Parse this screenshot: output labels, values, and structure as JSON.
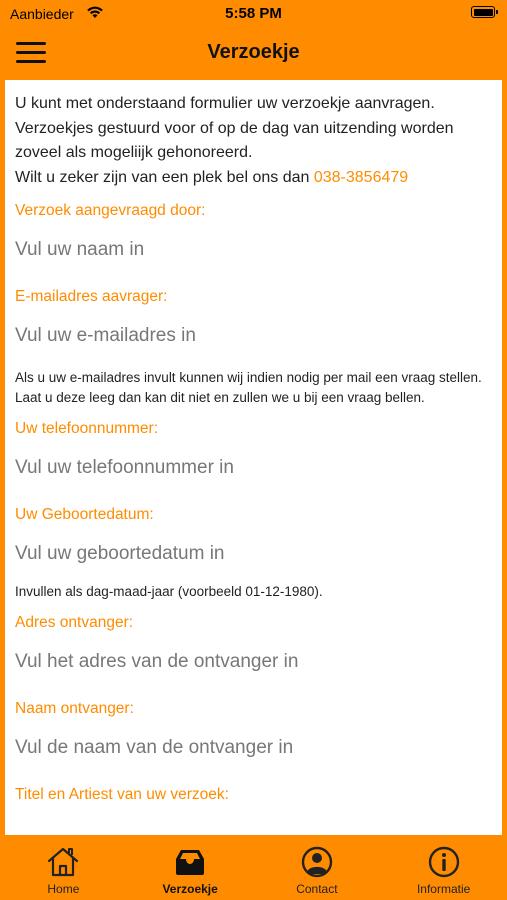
{
  "status_bar": {
    "carrier": "Aanbieder",
    "time": "5:58 PM"
  },
  "header": {
    "title": "Verzoekje"
  },
  "intro": {
    "line1": "U kunt met onderstaand formulier uw verzoekje aanvragen.",
    "line2": "Verzoekjes gestuurd voor of op de dag van uitzending worden zoveel als mogeliijk gehonoreerd.",
    "line3": "Wilt u zeker zijn van een plek bel ons dan",
    "phone": "038-3856479"
  },
  "form": {
    "name": {
      "label": "Verzoek aangevraagd door:",
      "placeholder": "Vul uw naam in",
      "value": ""
    },
    "email": {
      "label": "E-mailadres aavrager:",
      "placeholder": "Vul uw e-mailadres in",
      "value": "",
      "hint": "Als u uw e-mailadres invult kunnen wij indien nodig per mail een vraag stellen. Laat u deze leeg dan kan dit niet en zullen we u bij een vraag bellen."
    },
    "phone": {
      "label": "Uw telefoonnummer:",
      "placeholder": "Vul uw telefoonnummer in",
      "value": ""
    },
    "birthdate": {
      "label": "Uw Geboortedatum:",
      "placeholder": "Vul uw geboortedatum in",
      "value": "",
      "hint": "Invullen als dag-maad-jaar (voorbeeld 01-12-1980)."
    },
    "recipient_address": {
      "label": "Adres ontvanger:",
      "placeholder": "Vul het adres van de ontvanger in",
      "value": ""
    },
    "recipient_name": {
      "label": "Naam ontvanger:",
      "placeholder": "Vul de naam van de ontvanger in",
      "value": ""
    },
    "song": {
      "label": "Titel en Artiest van uw verzoek:"
    }
  },
  "tabs": [
    {
      "label": "Home",
      "icon": "home-icon"
    },
    {
      "label": "Verzoekje",
      "icon": "inbox-icon",
      "active": true
    },
    {
      "label": "Contact",
      "icon": "user-circle-icon"
    },
    {
      "label": "Informatie",
      "icon": "info-icon"
    }
  ],
  "colors": {
    "accent": "#ff8c00",
    "background": "#ffffff"
  }
}
